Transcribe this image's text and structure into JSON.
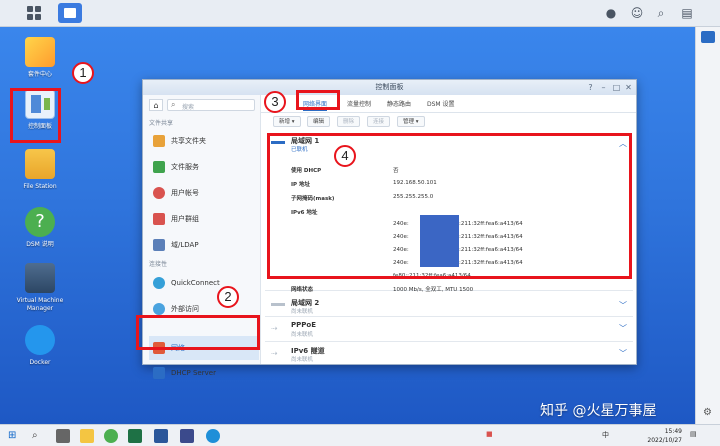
{
  "desktop_icons": [
    {
      "id": "package-center",
      "label": "套件中心"
    },
    {
      "id": "control-panel",
      "label": "控制面板"
    },
    {
      "id": "file-station",
      "label": "File Station"
    },
    {
      "id": "dsm-help",
      "label": "DSM 说明"
    },
    {
      "id": "vmm",
      "label": "Virtual Machine Manager"
    },
    {
      "id": "docker",
      "label": "Docker"
    }
  ],
  "annotations": [
    "1",
    "2",
    "3",
    "4"
  ],
  "window": {
    "title": "控制面板",
    "search_placeholder": "搜索",
    "sidebar": {
      "section_file_sharing": "文件共享",
      "section_connectivity": "连接性",
      "items": [
        {
          "label": "共享文件夹",
          "color": "#e8a23a"
        },
        {
          "label": "文件服务",
          "color": "#3fa34d"
        },
        {
          "label": "用户帐号",
          "color": "#d9534f"
        },
        {
          "label": "用户群组",
          "color": "#d9534f"
        },
        {
          "label": "域/LDAP",
          "color": "#5b7fb8"
        },
        {
          "label": "QuickConnect",
          "color": "#35a0d8"
        },
        {
          "label": "外部访问",
          "color": "#4aa3df"
        },
        {
          "label": "网络",
          "color": "#e05a3a"
        },
        {
          "label": "DHCP Server",
          "color": "#2b6cc4"
        }
      ]
    },
    "tabs": [
      "常规",
      "网络界面",
      "流量控制",
      "静态路由",
      "DSM 设置"
    ],
    "toolbar": {
      "create": "新增 ▾",
      "edit": "编辑",
      "delete": "删除",
      "connect": "连接",
      "manage": "管理 ▾"
    },
    "interfaces": [
      {
        "name": "局域网 1",
        "status": "已联机",
        "expanded": true
      },
      {
        "name": "局域网 2",
        "status": "尚未联机",
        "expanded": false
      },
      {
        "name": "PPPoE",
        "status": "尚未联机",
        "expanded": false
      },
      {
        "name": "IPv6 隧道",
        "status": "尚未联机",
        "expanded": false
      }
    ],
    "details": {
      "dhcp_label": "使用 DHCP",
      "dhcp_value": "否",
      "ip_label": "IP 地址",
      "ip_value": "192.168.50.101",
      "mask_label": "子网掩码(mask)",
      "mask_value": "255.255.255.0",
      "ipv6_label": "IPv6 地址",
      "ipv6_values": [
        "240e:",
        "240e:",
        "240e:",
        "240e:"
      ],
      "ipv6_suffix": ":211:32ff:fea6:a413/64",
      "ipv6_link_local": "fe80::211:32ff:fea6:a413/64",
      "status_label": "网络状态",
      "status_value": "1000 Mb/s, 全双工, MTU 1500"
    }
  },
  "watermark": "知乎 @火星万事屋",
  "taskbar": {
    "time": "15:49",
    "date": "2022/10/27",
    "ime": "中"
  },
  "colors": {
    "annotation_red": "#e8141c",
    "accent": "#2b6cc4"
  }
}
